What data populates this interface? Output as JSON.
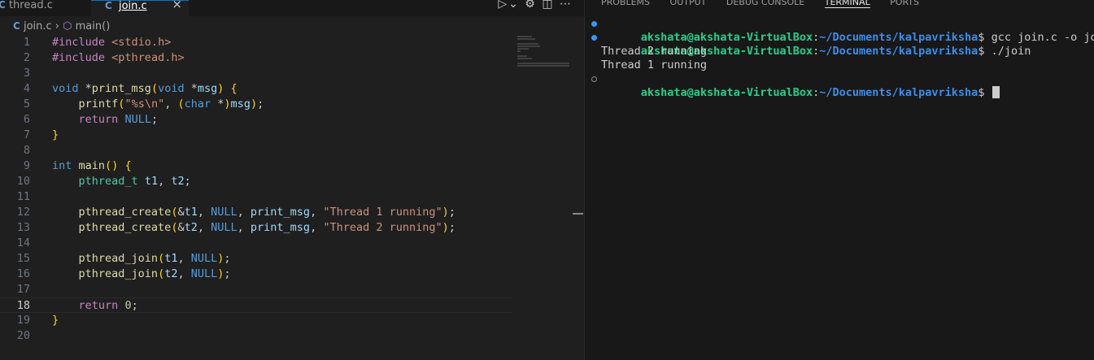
{
  "tabs": [
    {
      "icon": "C",
      "label": "thread.c"
    },
    {
      "icon": "C",
      "label": "join.c",
      "close": "×"
    }
  ],
  "breadcrumb": {
    "icon": "C",
    "file": "join.c",
    "symbol": "main()"
  },
  "code_lines": [
    {
      "n": "1",
      "text": "#include <stdio.h>"
    },
    {
      "n": "2",
      "text": "#include <pthread.h>"
    },
    {
      "n": "3",
      "text": ""
    },
    {
      "n": "4",
      "text": "void *print_msg(void *msg) {"
    },
    {
      "n": "5",
      "text": "    printf(\"%s\\n\", (char *)msg);"
    },
    {
      "n": "6",
      "text": "    return NULL;"
    },
    {
      "n": "7",
      "text": "}"
    },
    {
      "n": "8",
      "text": ""
    },
    {
      "n": "9",
      "text": "int main() {"
    },
    {
      "n": "10",
      "text": "    pthread_t t1, t2;"
    },
    {
      "n": "11",
      "text": ""
    },
    {
      "n": "12",
      "text": "    pthread_create(&t1, NULL, print_msg, \"Thread 1 running\");"
    },
    {
      "n": "13",
      "text": "    pthread_create(&t2, NULL, print_msg, \"Thread 2 running\");"
    },
    {
      "n": "14",
      "text": ""
    },
    {
      "n": "15",
      "text": "    pthread_join(t1, NULL);"
    },
    {
      "n": "16",
      "text": "    pthread_join(t2, NULL);"
    },
    {
      "n": "17",
      "text": ""
    },
    {
      "n": "18",
      "text": "    return 0;"
    },
    {
      "n": "19",
      "text": "}"
    },
    {
      "n": "20",
      "text": ""
    }
  ],
  "current_line": "18",
  "panel_tabs": [
    "PROBLEMS",
    "OUTPUT",
    "DEBUG CONSOLE",
    "TERMINAL",
    "PORTS"
  ],
  "active_panel_tab": "TERMINAL",
  "terminal": {
    "prompt_user": "akshata@akshata-VirtualBox",
    "prompt_sep": ":",
    "prompt_path": "~/Documents/kalpavriksha",
    "prompt_end": "$ ",
    "commands": [
      "gcc join.c -o join",
      "./join"
    ],
    "output": [
      "Thread 2 running",
      "Thread 1 running"
    ]
  },
  "icons": {
    "run": "run-debug-icon",
    "settings": "gear-icon",
    "split": "split-editor-icon",
    "more": "more-icon",
    "symbol": "symbol-method-icon"
  }
}
